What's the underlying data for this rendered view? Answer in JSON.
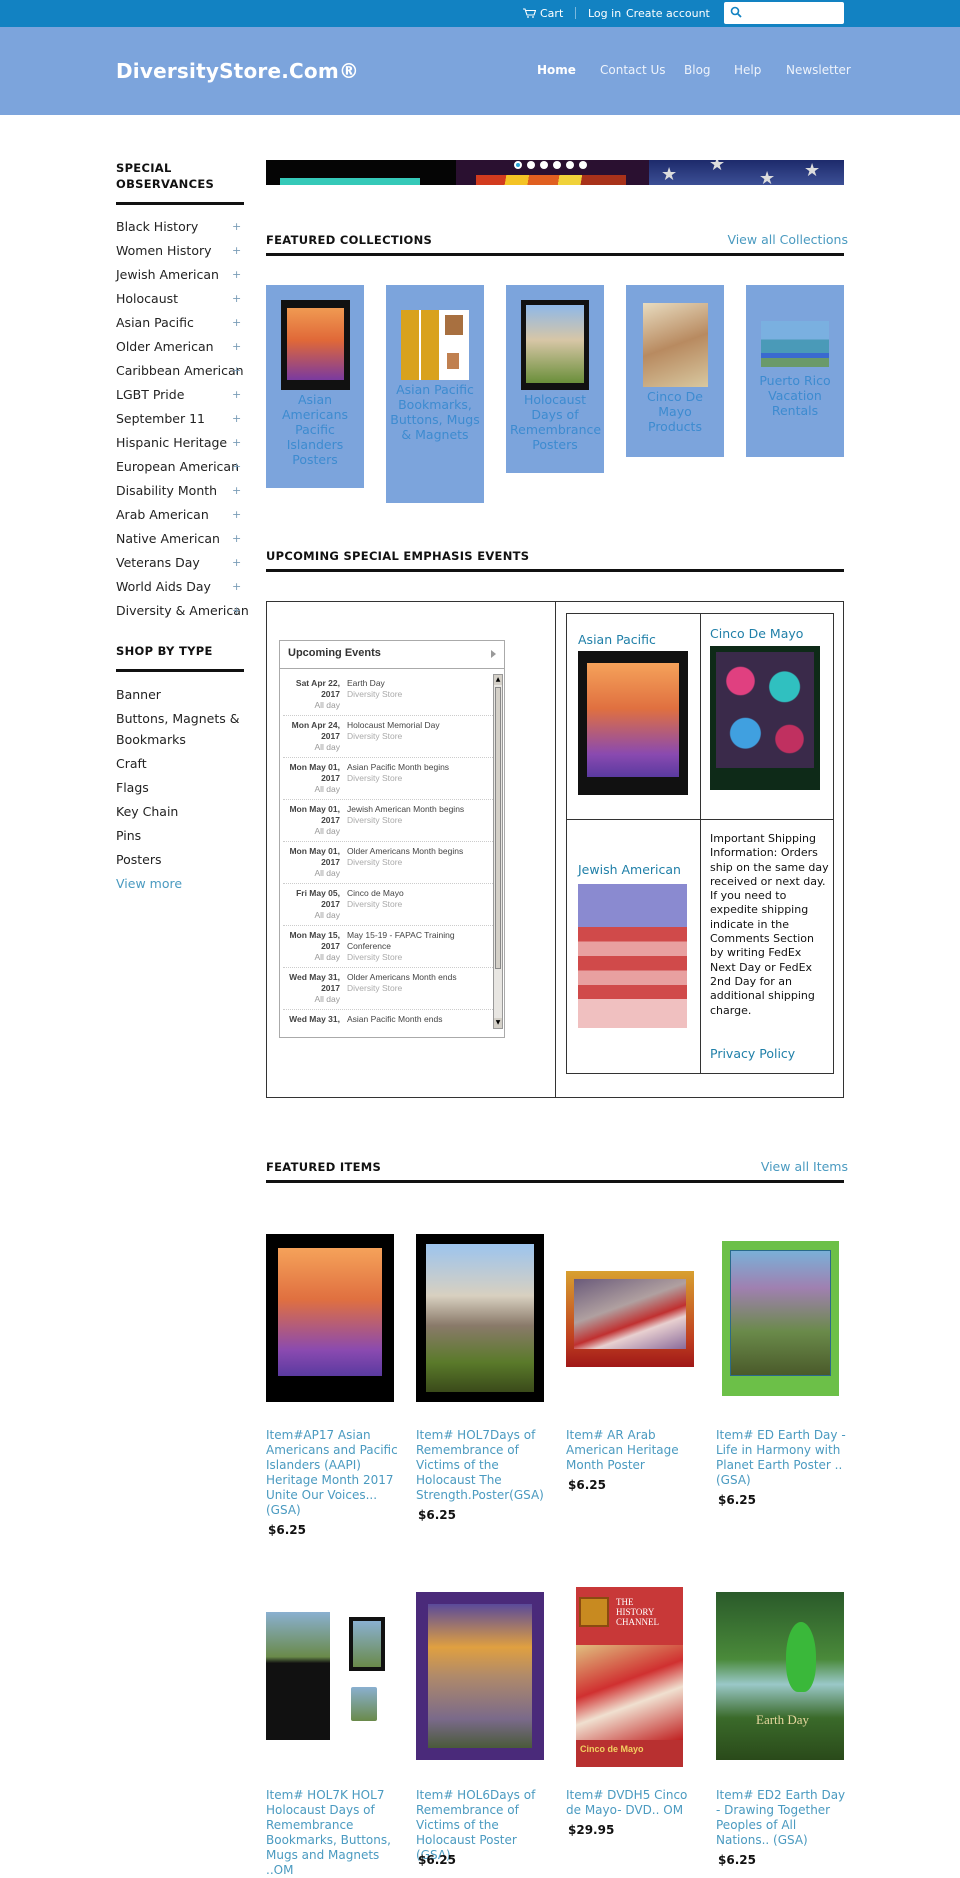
{
  "topbar": {
    "cart_label": "Cart",
    "login_label": "Log in",
    "create_account_label": "Create account",
    "search_placeholder": ""
  },
  "header": {
    "logo": "DiversityStore.Com®",
    "nav": [
      "Home",
      "Contact Us",
      "Blog",
      "Help",
      "Newsletter"
    ],
    "active_nav": "Home",
    "colors": {
      "topbar": "#1282c2",
      "header": "#7ca4dc",
      "link": "#4a9ac0"
    }
  },
  "sidebar": {
    "observances_title": "SPECIAL OBSERVANCES",
    "observances": [
      "Black History",
      "Women History",
      "Jewish American",
      "Holocaust",
      "Asian Pacific",
      "Older American",
      "Caribbean American",
      "LGBT Pride",
      "September 11",
      "Hispanic Heritage",
      "European American",
      "Disability Month",
      "Arab American",
      "Native American",
      "Veterans Day",
      "World Aids Day",
      "Diversity & American"
    ],
    "expand_symbol": "+",
    "shop_by_type_title": "SHOP BY TYPE",
    "types": [
      "Banner",
      "Buttons, Magnets & Bookmarks",
      "Craft",
      "Flags",
      "Key Chain",
      "Pins",
      "Posters"
    ],
    "view_more": "View more"
  },
  "slideshow": {
    "slide_count": 6,
    "active_slide": 1
  },
  "featured_collections": {
    "title": "FEATURED COLLECTIONS",
    "view_all": "View all Collections",
    "items": [
      "Asian Americans Pacific Islanders Posters",
      "Asian Pacific Bookmarks, Buttons, Mugs & Magnets",
      "Holocaust Days of Remembrance Posters",
      "Cinco De Mayo Products",
      "Puerto Rico Vacation Rentals"
    ]
  },
  "events": {
    "title": "UPCOMING SPECIAL EMPHASIS EVENTS",
    "widget_title": "Upcoming Events",
    "list": [
      {
        "date": "Sat Apr 22,",
        "year": "2017",
        "name": "Earth Day",
        "calendar": "Diversity Store",
        "time": "All day"
      },
      {
        "date": "Mon Apr 24,",
        "year": "2017",
        "name": "Holocaust Memorial Day",
        "calendar": "Diversity Store",
        "time": "All day"
      },
      {
        "date": "Mon May 01,",
        "year": "2017",
        "name": "Asian Pacific Month begins",
        "calendar": "Diversity Store",
        "time": "All day"
      },
      {
        "date": "Mon May 01,",
        "year": "2017",
        "name": "Jewish American Month begins",
        "calendar": "Diversity Store",
        "time": "All day"
      },
      {
        "date": "Mon May 01,",
        "year": "2017",
        "name": "Older Americans Month begins",
        "calendar": "Diversity Store",
        "time": "All day"
      },
      {
        "date": "Fri May 05,",
        "year": "2017",
        "name": "Cinco de Mayo",
        "calendar": "Diversity Store",
        "time": "All day"
      },
      {
        "date": "Mon May 15,",
        "year": "2017",
        "name": "May 15-19 - FAPAC Training Conference",
        "calendar": "Diversity Store",
        "time": "All day"
      },
      {
        "date": "Wed May 31,",
        "year": "2017",
        "name": "Older Americans Month ends",
        "calendar": "Diversity Store",
        "time": "All day"
      },
      {
        "date": "Wed May 31,",
        "year": "",
        "name": "Asian Pacific Month ends",
        "calendar": "",
        "time": ""
      }
    ],
    "grid": {
      "asian_pacific": "Asian Pacific",
      "cinco_de_mayo": "Cinco De Mayo",
      "jewish_american": "Jewish American",
      "shipping_info": "Important Shipping Information: Orders ship on the same day received or next day. If you need to expedite shipping indicate in the Comments Section by writing FedEx Next Day or FedEx 2nd Day for an additional shipping charge.",
      "privacy_policy": "Privacy Policy"
    }
  },
  "featured_items": {
    "title": "FEATURED ITEMS",
    "view_all": "View all Items",
    "items": [
      {
        "title": "Item#AP17 Asian Americans and Pacific Islanders (AAPI) Heritage Month 2017 Unite Our Voices... (GSA)",
        "price": "$6.25"
      },
      {
        "title": "Item# HOL7Days of Remembrance of Victims of the Holocaust The Strength.Poster(GSA)",
        "price": "$6.25"
      },
      {
        "title": "Item# AR Arab American Heritage Month Poster",
        "price": "$6.25"
      },
      {
        "title": "Item# ED Earth Day - Life in Harmony with Planet Earth Poster .. (GSA)",
        "price": "$6.25"
      },
      {
        "title": "Item# HOL7K HOL7 Holocaust Days of Remembrance Bookmarks, Buttons, Mugs and Magnets ..OM",
        "price": ""
      },
      {
        "title": "Item# HOL6Days of Remembrance of Victims of the Holocaust Poster (GSA)",
        "price": "$6.25"
      },
      {
        "title": "Item# DVDH5 Cinco de Mayo- DVD.. OM",
        "price": "$29.95"
      },
      {
        "title": "Item# ED2 Earth Day - Drawing Together Peoples of All Nations.. (GSA)",
        "price": "$6.25"
      }
    ]
  }
}
